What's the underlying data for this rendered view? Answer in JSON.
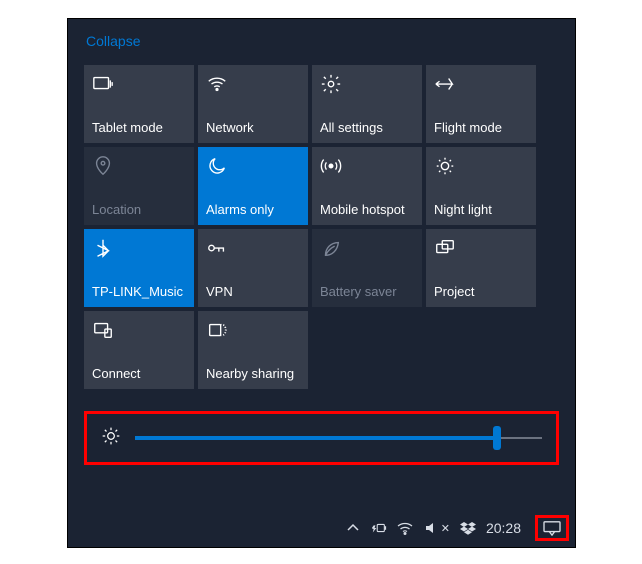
{
  "collapse_label": "Collapse",
  "tiles": [
    {
      "label": "Tablet mode",
      "icon": "tablet-icon"
    },
    {
      "label": "Network",
      "icon": "wifi-icon"
    },
    {
      "label": "All settings",
      "icon": "gear-icon"
    },
    {
      "label": "Flight mode",
      "icon": "airplane-icon"
    },
    {
      "label": "Location",
      "icon": "location-icon"
    },
    {
      "label": "Alarms only",
      "icon": "moon-icon"
    },
    {
      "label": "Mobile hotspot",
      "icon": "hotspot-icon"
    },
    {
      "label": "Night light",
      "icon": "nightlight-icon"
    },
    {
      "label": "TP-LINK_Music",
      "icon": "bluetooth-icon"
    },
    {
      "label": "VPN",
      "icon": "vpn-icon"
    },
    {
      "label": "Battery saver",
      "icon": "leaf-icon"
    },
    {
      "label": "Project",
      "icon": "project-icon"
    },
    {
      "label": "Connect",
      "icon": "connect-icon"
    },
    {
      "label": "Nearby sharing",
      "icon": "nearby-icon"
    }
  ],
  "tile_states": {
    "disabled_indices": [
      4,
      10
    ],
    "active_indices": [
      5,
      8
    ]
  },
  "brightness": {
    "value_percent": 89
  },
  "taskbar": {
    "clock": "20:28"
  },
  "highlight": {
    "brightness_row": true,
    "action_center_button": true,
    "color": "#ff0000"
  }
}
